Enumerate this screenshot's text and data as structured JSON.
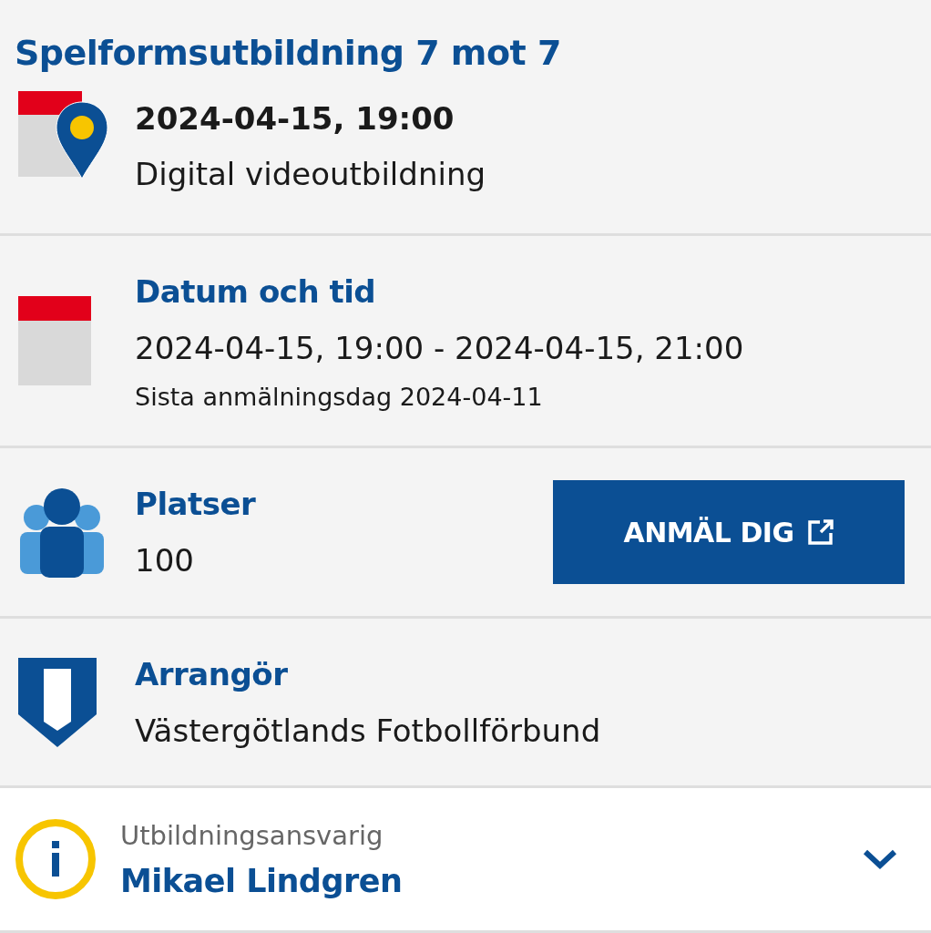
{
  "title": "Spelformsutbildning 7 mot 7",
  "summary": {
    "datetime": "2024-04-15, 19:00",
    "location": "Digital videoutbildning"
  },
  "sections": [
    {
      "kind": "calendar",
      "heading": "Datum och tid",
      "lines": [
        "2024-04-15, 19:00 - 2024-04-15, 21:00"
      ],
      "note": "Sista anmälningsdag 2024-04-11"
    },
    {
      "kind": "people",
      "heading": "Platser",
      "lines": [
        "100"
      ],
      "button": {
        "label": "ANMÄL DIG"
      }
    },
    {
      "kind": "shield",
      "heading": "Arrangör",
      "lines": [
        "Västergötlands Fotbollförbund"
      ]
    }
  ],
  "contact": {
    "label": "Utbildningsansvarig",
    "name": "Mikael Lindgren",
    "expanded": false
  }
}
